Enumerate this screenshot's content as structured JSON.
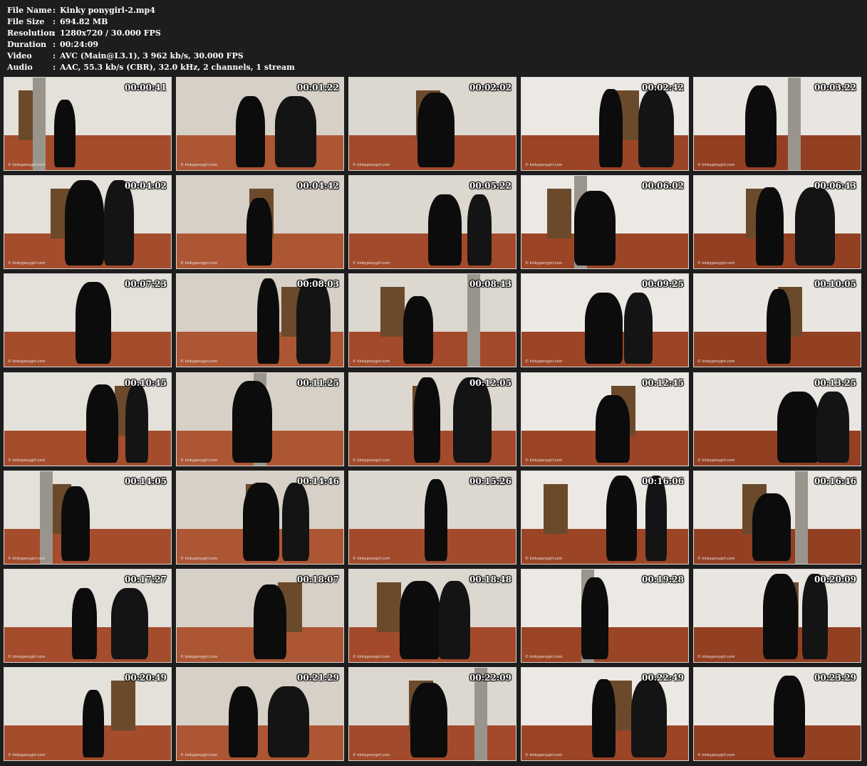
{
  "info": {
    "rows": [
      {
        "label": "File Name",
        "sep": ":",
        "value": "Kinky ponygirl-2.mp4"
      },
      {
        "label": "File Size",
        "sep": ":",
        "value": "694.82 MB"
      },
      {
        "label": "Resolution",
        "sep": ":",
        "value": "1280x720 / 30.000 FPS"
      },
      {
        "label": "Duration",
        "sep": ":",
        "value": "00:24:09"
      },
      {
        "label": "Video",
        "sep": ":",
        "value": "AVC (Main@L3.1), 3 962 kb/s, 30.000 FPS"
      },
      {
        "label": "Audio",
        "sep": ":",
        "value": "AAC, 55.3 kb/s (CBR), 32.0 kHz, 2 channels, 1 stream"
      }
    ]
  },
  "watermark": "© kinkyponygirl.com",
  "colors": {
    "background": "#1d1d1d",
    "text": "#ffffff",
    "thumb_border": "#d8d8d8",
    "wall": "#e6e2dc",
    "floor": "#a9512f"
  },
  "thumbnails": [
    "00:00:41",
    "00:01:22",
    "00:02:02",
    "00:02:42",
    "00:03:22",
    "00:04:02",
    "00:04:42",
    "00:05:22",
    "00:06:02",
    "00:06:43",
    "00:07:23",
    "00:08:03",
    "00:08:43",
    "00:09:25",
    "00:10:05",
    "00:10:45",
    "00:11:25",
    "00:12:05",
    "00:12:45",
    "00:13:25",
    "00:14:05",
    "00:14:46",
    "00:15:26",
    "00:16:06",
    "00:16:46",
    "00:17:27",
    "00:18:07",
    "00:18:48",
    "00:19:28",
    "00:20:09",
    "00:20:49",
    "00:21:29",
    "00:22:09",
    "00:22:49",
    "00:23:29"
  ]
}
